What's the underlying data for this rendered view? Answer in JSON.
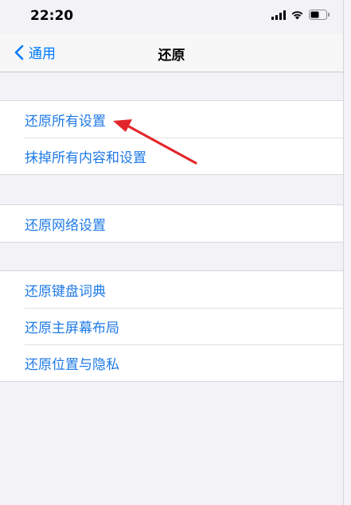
{
  "status_bar": {
    "time": "22:20"
  },
  "nav": {
    "back_label": "通用",
    "title": "还原"
  },
  "groups": [
    {
      "items": [
        "还原所有设置",
        "抹掉所有内容和设置"
      ]
    },
    {
      "items": [
        "还原网络设置"
      ]
    },
    {
      "items": [
        "还原键盘词典",
        "还原主屏幕布局",
        "还原位置与隐私"
      ]
    }
  ],
  "colors": {
    "accent": "#1f7ae6",
    "background": "#f2f2f7",
    "annotation_arrow": "#e3262b"
  }
}
